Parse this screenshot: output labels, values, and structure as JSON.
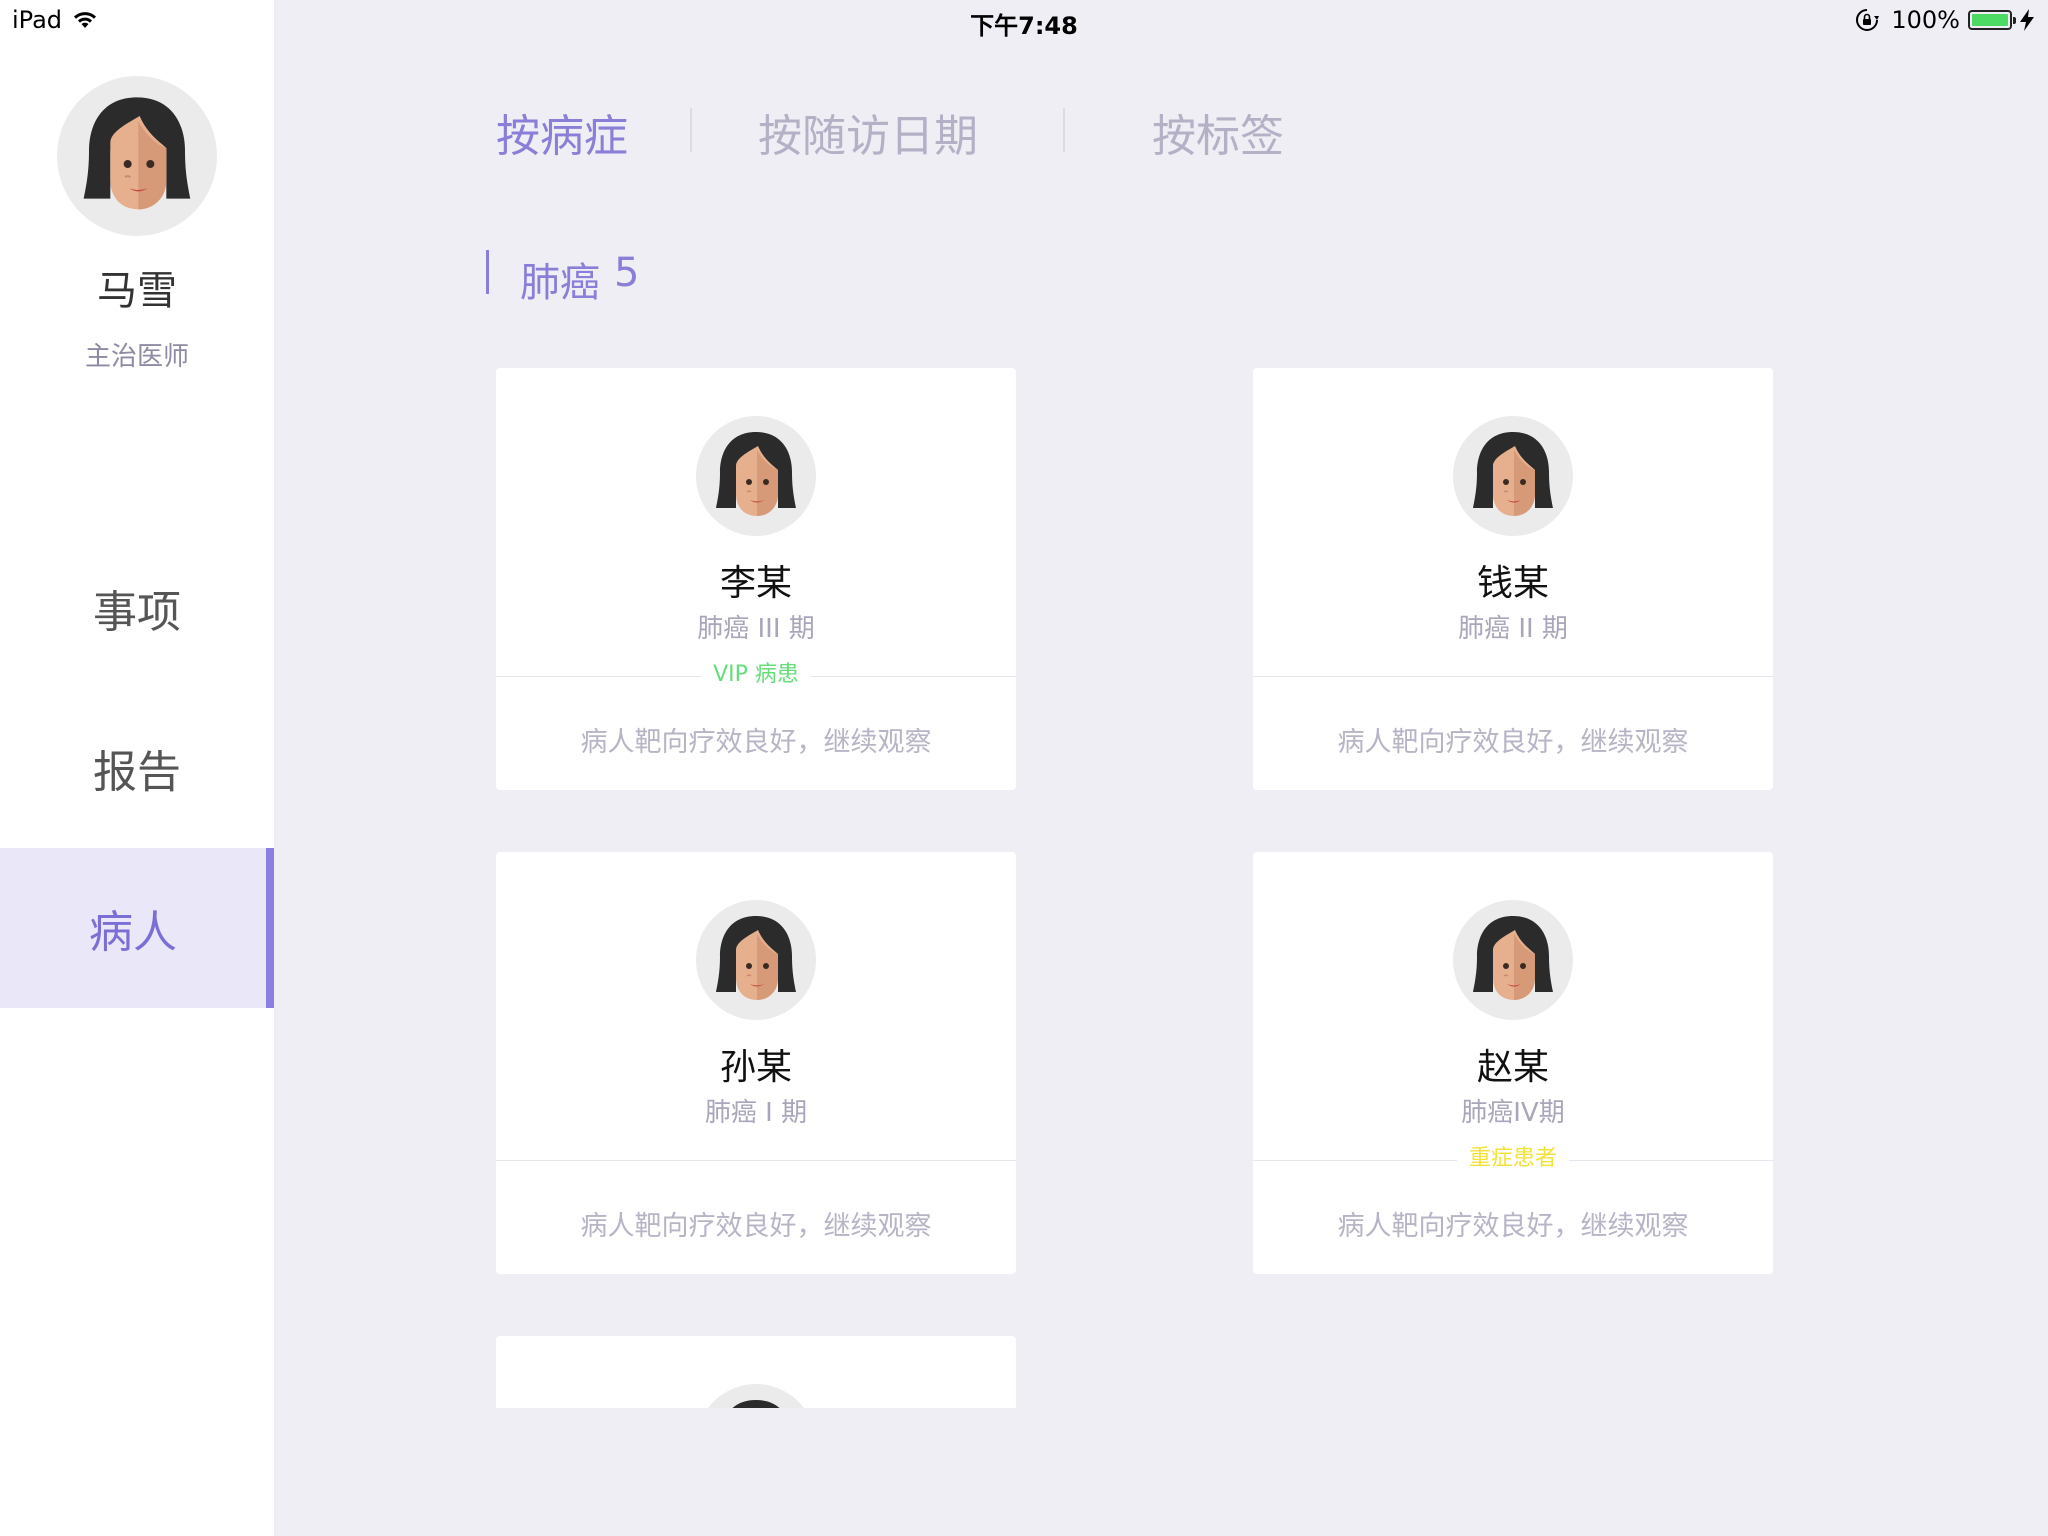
{
  "status_bar": {
    "device": "iPad",
    "time": "下午7:48",
    "battery_pct": "100%",
    "battery_level": 1.0,
    "battery_color": "#4cd964"
  },
  "sidebar": {
    "doctor_name": "马雪",
    "doctor_title": "主治医师",
    "nav": [
      {
        "label": "事项",
        "active": false
      },
      {
        "label": "报告",
        "active": false
      },
      {
        "label": "病人",
        "active": true
      }
    ]
  },
  "tabs": [
    {
      "label": "按病症",
      "active": true
    },
    {
      "label": "按随访日期",
      "active": false
    },
    {
      "label": "按标签",
      "active": false
    }
  ],
  "section": {
    "title": "肺癌",
    "count": "5"
  },
  "patients": [
    {
      "name": "李某",
      "stage": "肺癌 III 期",
      "tag": "VIP 病患",
      "tag_color": "#66dd78",
      "note": "病人靶向疗效良好，继续观察"
    },
    {
      "name": "钱某",
      "stage": "肺癌 II 期",
      "tag": "",
      "note": "病人靶向疗效良好，继续观察"
    },
    {
      "name": "孙某",
      "stage": "肺癌 I 期",
      "tag": "",
      "note": "病人靶向疗效良好，继续观察"
    },
    {
      "name": "赵某",
      "stage": "肺癌IV期",
      "tag": "重症患者",
      "tag_color": "#f2e23a",
      "note": "病人靶向疗效良好，继续观察"
    }
  ],
  "colors": {
    "accent": "#8a7fd8",
    "background": "#efeef4",
    "nav_active_bg": "#e9e7f8"
  },
  "icons": {
    "avatar": "female-avatar-icon",
    "wifi": "wifi-icon",
    "lock": "rotation-lock-icon",
    "battery": "battery-icon",
    "charging": "charging-bolt-icon"
  }
}
